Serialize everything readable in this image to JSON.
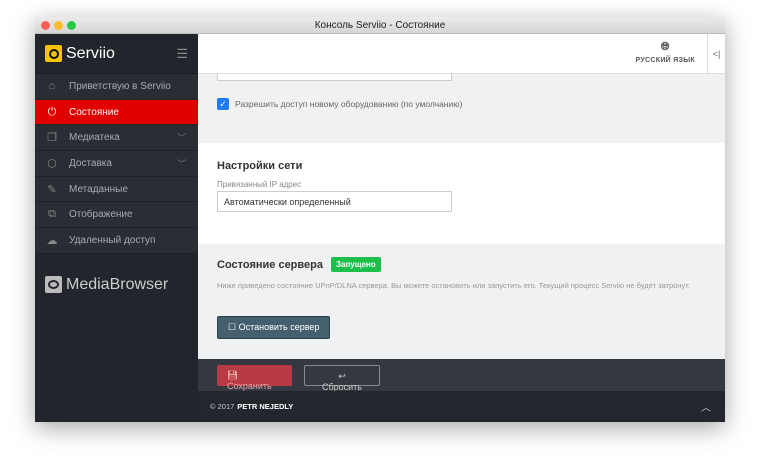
{
  "window": {
    "title": "Консоль Serviio - Состояние"
  },
  "sidebar": {
    "brand": "Serviio",
    "items": [
      {
        "label": "Приветствую в Serviio",
        "icon": "home-icon"
      },
      {
        "label": "Состояние",
        "icon": "plug-icon",
        "active": true
      },
      {
        "label": "Медиатека",
        "icon": "library-icon",
        "expandable": true
      },
      {
        "label": "Доставка",
        "icon": "box-icon",
        "expandable": true
      },
      {
        "label": "Метаданные",
        "icon": "edit-icon"
      },
      {
        "label": "Отображение",
        "icon": "display-icon"
      },
      {
        "label": "Удаленный доступ",
        "icon": "cloud-icon"
      }
    ],
    "mediabrowser": "MediaBrowser"
  },
  "header": {
    "language": "РУССКИЙ ЯЗЫК"
  },
  "access": {
    "checkbox_label": "Разрешить доступ новому оборудованию (по умолчанию)",
    "checked": true
  },
  "network": {
    "title": "Настройки сети",
    "ip_label": "Привязанный IP адрес",
    "ip_value": "Автоматически определенный"
  },
  "server": {
    "title": "Состояние сервера",
    "status": "Запущено",
    "description": "Ниже приведено состояние UPnP/DLNA сервера. Вы можете остановить или запустить его. Текущий процесс Serviio не будет затронут.",
    "stop_label": "Остановить сервер"
  },
  "actions": {
    "save": "Сохранить",
    "reset": "Сбросить"
  },
  "footer": {
    "copyright": "© 2017",
    "author": "PETR NEJEDLY"
  },
  "colors": {
    "accent": "#e00000",
    "badge": "#1dbf4b"
  }
}
